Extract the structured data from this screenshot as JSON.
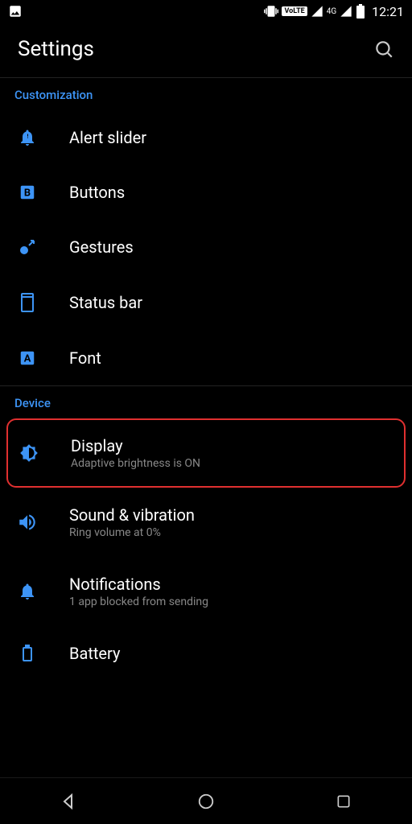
{
  "status": {
    "time": "12:21",
    "signal_label": "4G",
    "volte_label": "VoLTE"
  },
  "header": {
    "title": "Settings"
  },
  "sections": {
    "customization": {
      "label": "Customization",
      "items": [
        {
          "title": "Alert slider"
        },
        {
          "title": "Buttons"
        },
        {
          "title": "Gestures"
        },
        {
          "title": "Status bar"
        },
        {
          "title": "Font"
        }
      ]
    },
    "device": {
      "label": "Device",
      "items": [
        {
          "title": "Display",
          "sub": "Adaptive brightness is ON"
        },
        {
          "title": "Sound & vibration",
          "sub": "Ring volume at 0%"
        },
        {
          "title": "Notifications",
          "sub": "1 app blocked from sending"
        },
        {
          "title": "Battery",
          "sub": ""
        }
      ]
    }
  }
}
